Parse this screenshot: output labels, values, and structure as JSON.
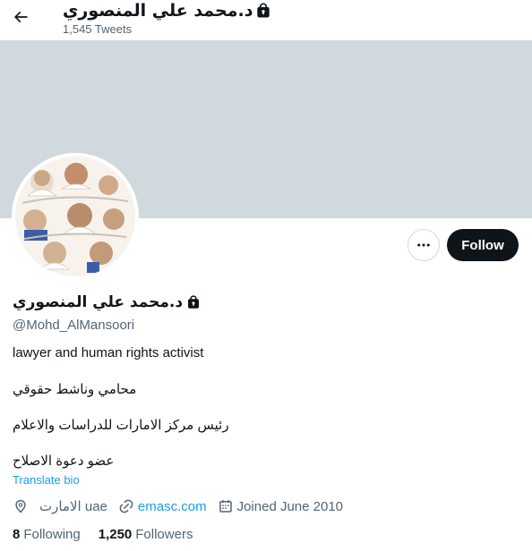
{
  "header": {
    "back_icon": "arrow-left-icon",
    "title": "د.محمد علي المنصوري",
    "tweet_count": "1,545 Tweets"
  },
  "colors": {
    "banner": "#cfd9de",
    "accent": "#1d9bf0",
    "follow_button": "#0f1419"
  },
  "actions": {
    "more_icon": "more-dots-icon",
    "follow_label": "Follow"
  },
  "profile": {
    "display_name": "د.محمد علي المنصوري",
    "lock_icon": "lock-icon",
    "handle": "@Mohd_AlMansoori",
    "bio": [
      "lawyer and human rights activist",
      "محامي وناشط حقوقي",
      "رئيس مركز الامارات للدراسات والاعلام",
      "عضو دعوة الاصلاح"
    ],
    "translate_label": "Translate bio",
    "location": "الامارت uae",
    "website": "emasc.com",
    "joined": "Joined June 2010",
    "following_count": "8",
    "following_label": "Following",
    "followers_count": "1,250",
    "followers_label": "Followers"
  }
}
